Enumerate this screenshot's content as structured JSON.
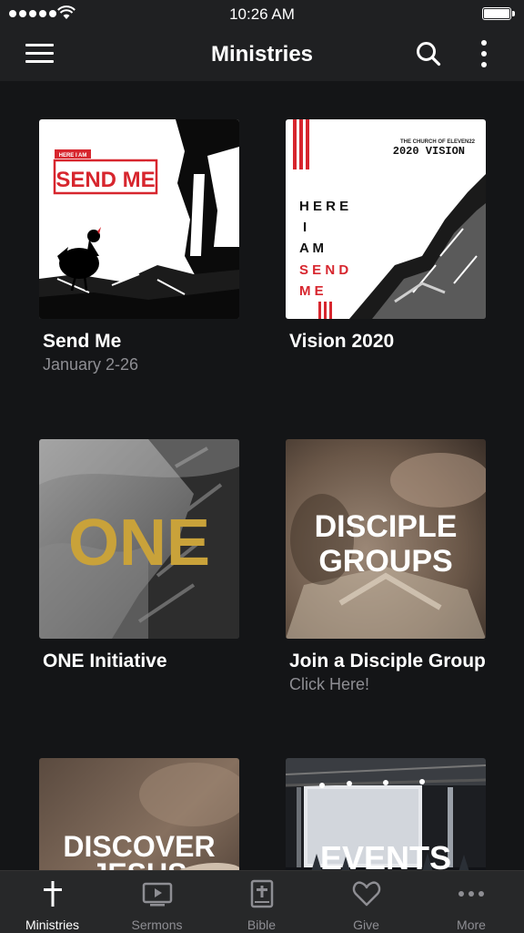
{
  "status_bar": {
    "time": "10:26 AM"
  },
  "nav": {
    "title": "Ministries"
  },
  "cards": [
    {
      "title": "Send Me",
      "subtitle": "January 2-26",
      "art": {
        "line1": "HERE I AM",
        "line2": "SEND ME"
      }
    },
    {
      "title": "Vision 2020",
      "subtitle": "",
      "art": {
        "church": "THE CHURCH OF ELEVEN22",
        "vision": "2020 VISION",
        "lines": [
          "H E R E",
          "I",
          "A M",
          "S E N D",
          "M E"
        ]
      }
    },
    {
      "title": "ONE Initiative",
      "subtitle": "",
      "art": {
        "word": "ONE"
      }
    },
    {
      "title": "Join a Disciple Group",
      "subtitle": "Click Here!",
      "art": {
        "line1": "DISCIPLE",
        "line2": "GROUPS"
      }
    },
    {
      "title": "",
      "subtitle": "",
      "art": {
        "line1": "DISCOVER",
        "line2": "JESUS"
      }
    },
    {
      "title": "",
      "subtitle": "",
      "art": {
        "line1": "EVENTS"
      }
    }
  ],
  "tabs": [
    {
      "label": "Ministries",
      "icon": "cross-icon",
      "active": true
    },
    {
      "label": "Sermons",
      "icon": "tv-play-icon",
      "active": false
    },
    {
      "label": "Bible",
      "icon": "bible-icon",
      "active": false
    },
    {
      "label": "Give",
      "icon": "heart-icon",
      "active": false
    },
    {
      "label": "More",
      "icon": "ellipsis-icon",
      "active": false
    }
  ],
  "colors": {
    "background": "#141517",
    "bar": "#1f2022",
    "tab_bar": "#272829",
    "accent_red": "#d7262e",
    "gold": "#c9a23a",
    "inactive": "#8e8e93"
  }
}
